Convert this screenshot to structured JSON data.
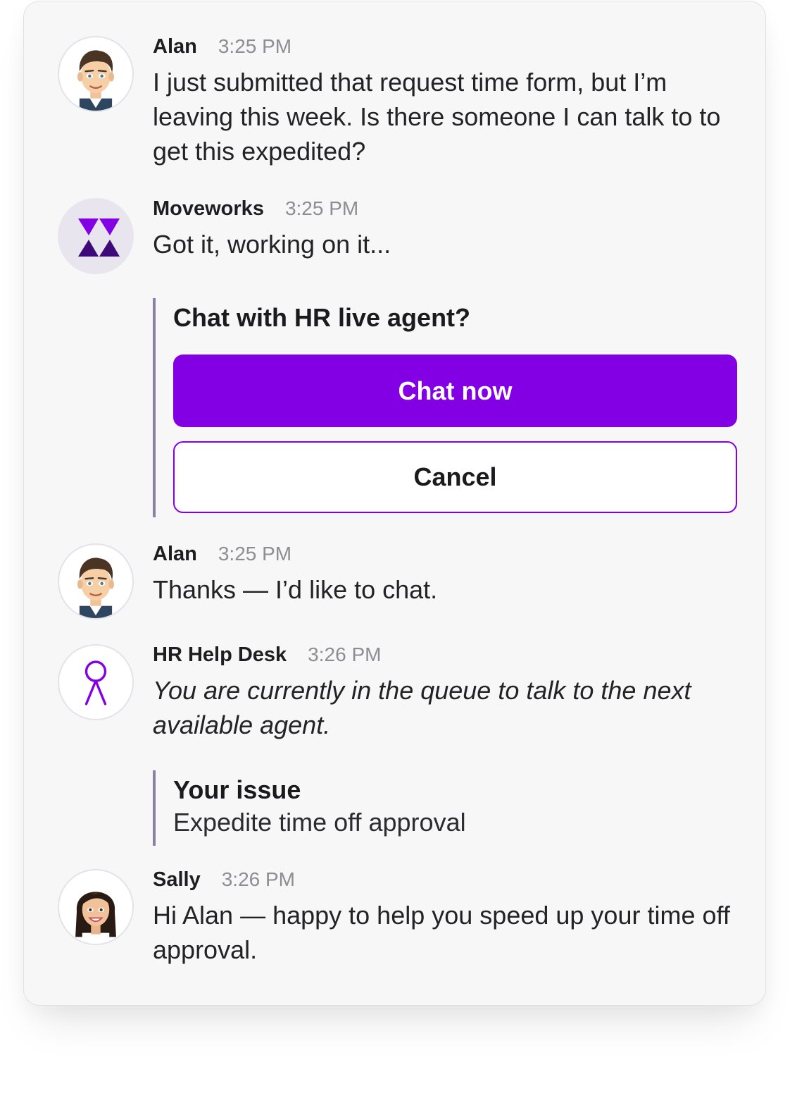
{
  "colors": {
    "accent": "#8300e5",
    "card_background": "#f7f7f8",
    "timestamp": "#8d8d92",
    "quote_bar": "#8b80a6"
  },
  "messages": [
    {
      "sender": "Alan",
      "time": "3:25 PM",
      "avatar": "alan-memoji-icon",
      "text": "I just submitted that request time form, but I’m leaving this week. Is there someone I can talk to to get this expedited?"
    },
    {
      "sender": "Moveworks",
      "time": "3:25 PM",
      "avatar": "moveworks-logo-icon",
      "text": "Got it, working on it..."
    },
    {
      "sender": "Alan",
      "time": "3:25 PM",
      "avatar": "alan-memoji-icon",
      "text": "Thanks — I’d like to chat."
    },
    {
      "sender": "HR Help Desk",
      "time": "3:26 PM",
      "avatar": "hr-person-icon",
      "text": "You are currently in the queue to talk to the next available agent."
    },
    {
      "sender": "Sally",
      "time": "3:26 PM",
      "avatar": "sally-memoji-icon",
      "text": "Hi Alan — happy to help you speed up your time off approval."
    }
  ],
  "live_agent_prompt": {
    "title": "Chat with HR live agent?",
    "primary_label": "Chat now",
    "secondary_label": "Cancel"
  },
  "issue_card": {
    "title": "Your issue",
    "description": "Expedite time off approval"
  }
}
